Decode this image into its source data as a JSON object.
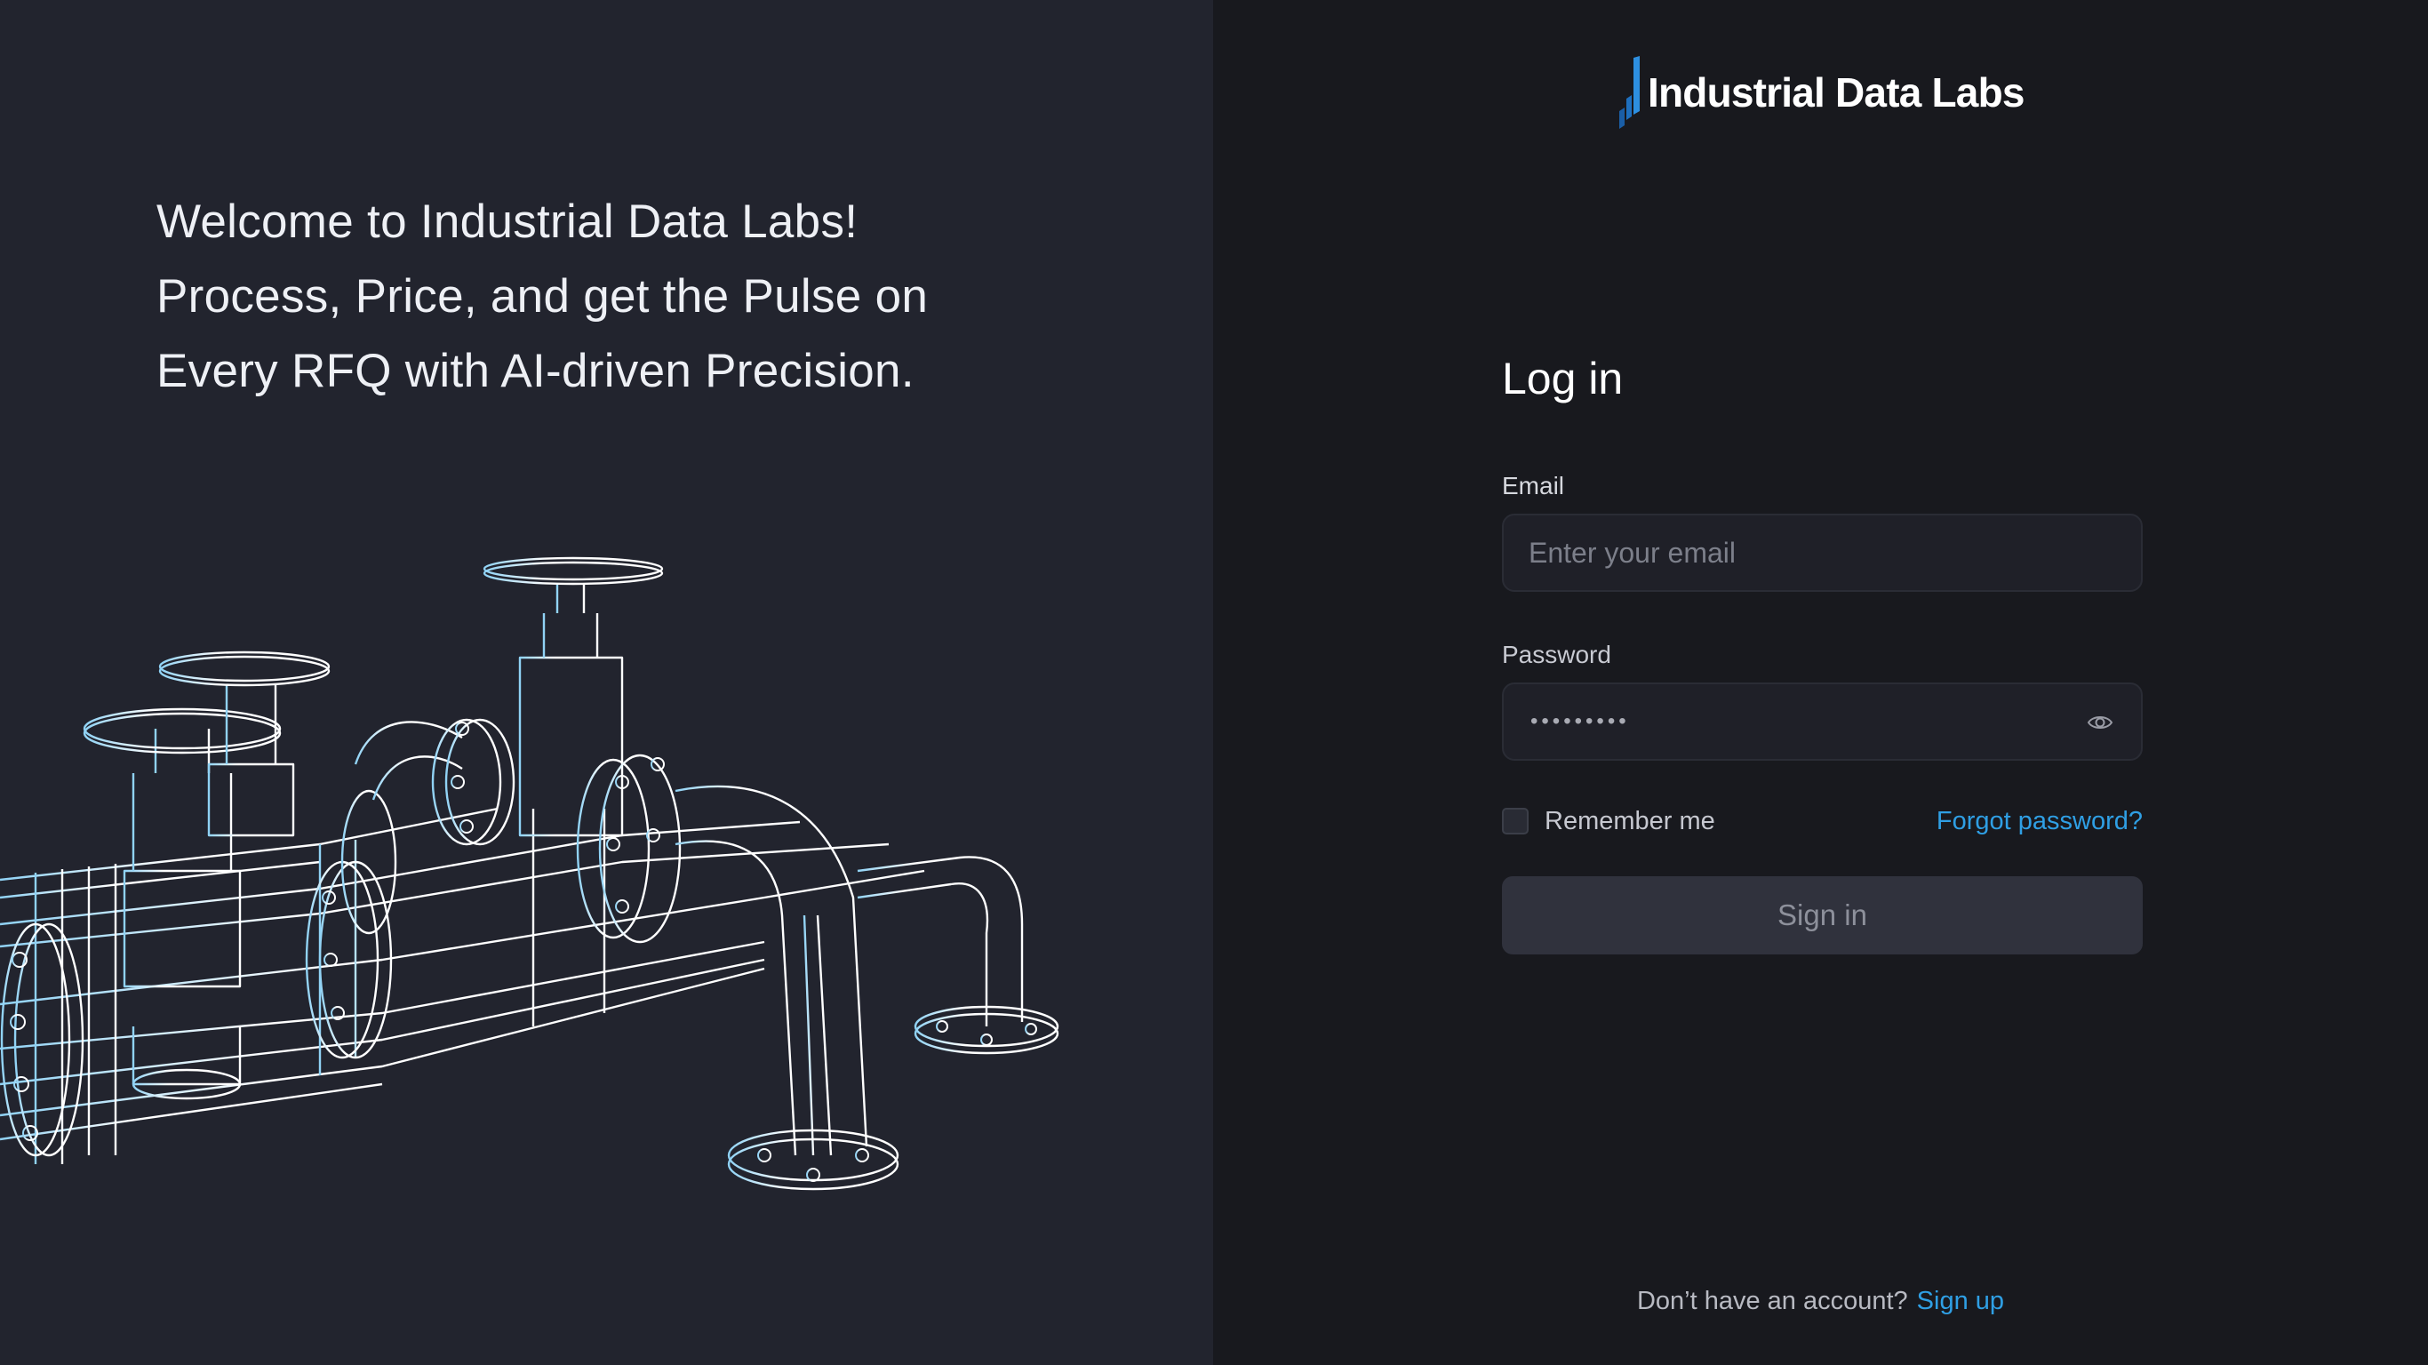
{
  "hero": {
    "line1": "Welcome to Industrial Data Labs!",
    "line2": "Process, Price, and get the Pulse on",
    "line3": "Every RFQ with AI-driven Precision."
  },
  "brand": {
    "name": "Industrial Data Labs",
    "mark_color": "#1e78c8"
  },
  "login": {
    "title": "Log in",
    "email_label": "Email",
    "email_placeholder": "Enter your email",
    "email_value": "",
    "password_label": "Password",
    "password_value": "•••••••••",
    "remember_label": "Remember me",
    "remember_checked": false,
    "forgot_label": "Forgot password?",
    "submit_label": "Sign in"
  },
  "footer": {
    "question": "Don’t have an account?",
    "signup_label": "Sign up"
  },
  "colors": {
    "left_panel": "#22242e",
    "right_panel": "#18191e",
    "link": "#2f9fe4",
    "button_bg": "#30323d"
  },
  "icons": {
    "password_toggle": "eye-icon",
    "illustration": "pipeline-valves-wireframe"
  }
}
